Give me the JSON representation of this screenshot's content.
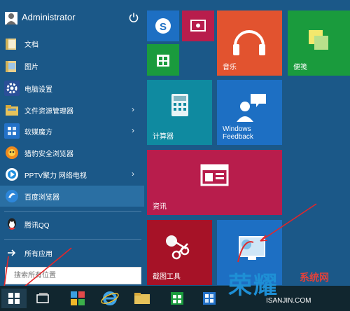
{
  "user": {
    "name": "Administrator"
  },
  "menu": {
    "items": [
      {
        "label": "文档",
        "icon": "folder-icon",
        "chevron": ""
      },
      {
        "label": "图片",
        "icon": "folder-icon",
        "chevron": ""
      },
      {
        "label": "电脑设置",
        "icon": "settings-icon",
        "chevron": ""
      },
      {
        "label": "文件资源管理器",
        "icon": "file-explorer-icon",
        "chevron": "›"
      },
      {
        "label": "软媒魔方",
        "icon": "ruanmei-mofang-icon",
        "chevron": "›"
      },
      {
        "label": "猎豹安全浏览器",
        "icon": "liebao-browser-icon",
        "chevron": ""
      },
      {
        "label": "PPTV聚力 网络电视",
        "icon": "pptv-icon",
        "chevron": "›"
      },
      {
        "label": "百度浏览器",
        "icon": "baidu-browser-icon",
        "chevron": ""
      },
      {
        "label": "腾讯QQ",
        "icon": "qq-icon",
        "chevron": ""
      }
    ],
    "all_apps": "所有应用"
  },
  "search": {
    "placeholder": "搜索所有位置"
  },
  "tiles": {
    "music": "音乐",
    "sticky": "便笺",
    "calculator": "计算器",
    "feedback": "Windows\nFeedback",
    "news": "资讯",
    "snipping": "截图工具"
  },
  "watermark": {
    "brand": "荣耀",
    "brand_suffix": "系统网",
    "url": "ISANJIN.COM"
  },
  "colors": {
    "accent": "#1b5888",
    "tile_red": "#b81d4c",
    "tile_teal": "#0f8aa0",
    "tile_green": "#1a9b3d",
    "tile_blue": "#1d6fc3"
  }
}
